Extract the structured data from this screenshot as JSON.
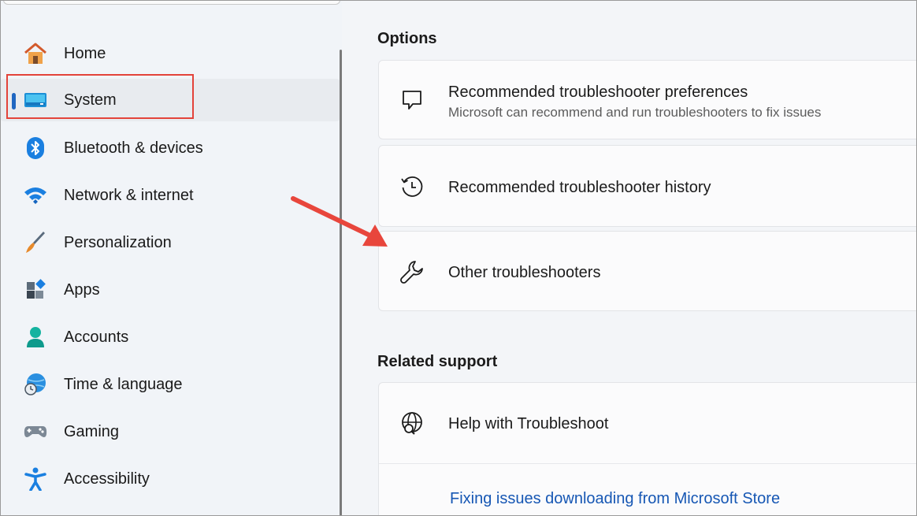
{
  "sidebar": {
    "items": [
      {
        "label": "Home",
        "icon": "home-icon"
      },
      {
        "label": "System",
        "icon": "system-icon",
        "selected": true
      },
      {
        "label": "Bluetooth & devices",
        "icon": "bluetooth-icon"
      },
      {
        "label": "Network & internet",
        "icon": "wifi-icon"
      },
      {
        "label": "Personalization",
        "icon": "brush-icon"
      },
      {
        "label": "Apps",
        "icon": "apps-icon"
      },
      {
        "label": "Accounts",
        "icon": "person-icon"
      },
      {
        "label": "Time & language",
        "icon": "globe-clock-icon"
      },
      {
        "label": "Gaming",
        "icon": "gamepad-icon"
      },
      {
        "label": "Accessibility",
        "icon": "accessibility-icon"
      }
    ]
  },
  "main": {
    "options_title": "Options",
    "options": [
      {
        "title": "Recommended troubleshooter preferences",
        "subtitle": "Microsoft can recommend and run troubleshooters to fix issues",
        "icon": "chat-bubble-icon"
      },
      {
        "title": "Recommended troubleshooter history",
        "icon": "history-icon"
      },
      {
        "title": "Other troubleshooters",
        "icon": "wrench-icon"
      }
    ],
    "related_title": "Related support",
    "related": {
      "help_title": "Help with Troubleshoot",
      "help_icon": "globe-search-icon",
      "link": "Fixing issues downloading from Microsoft Store"
    }
  },
  "colors": {
    "accent": "#1f66c1",
    "highlight_box": "#e3433a",
    "link": "#1657b4"
  }
}
